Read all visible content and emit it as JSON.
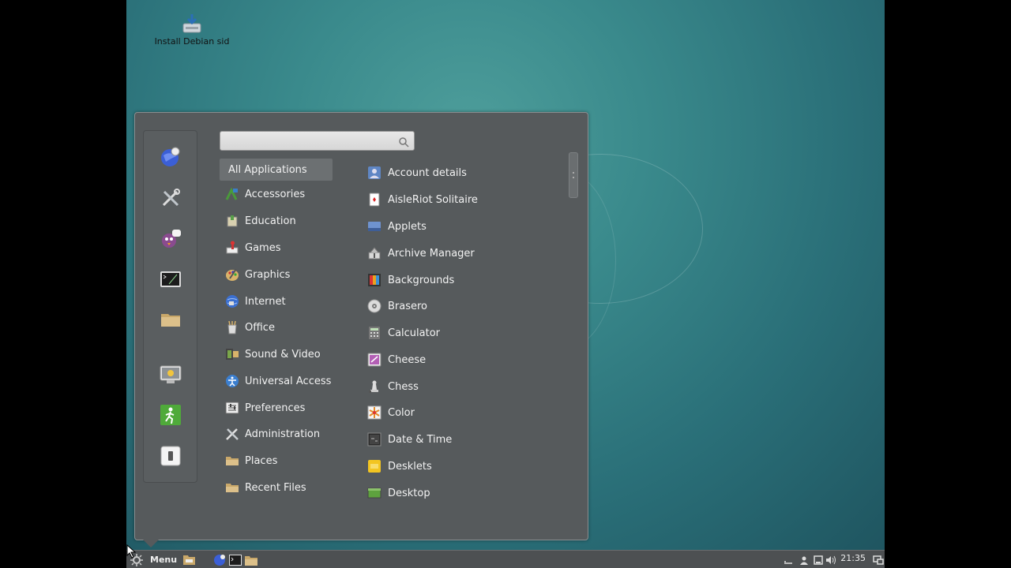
{
  "desktop": {
    "icons": [
      {
        "label": "Install Debian sid",
        "icon": "installer-icon"
      }
    ]
  },
  "menu": {
    "search": {
      "value": "",
      "placeholder": ""
    },
    "favorites": [
      {
        "name": "web-browser-icon"
      },
      {
        "name": "settings-tools-icon"
      },
      {
        "name": "chat-messenger-icon"
      },
      {
        "name": "terminal-icon"
      },
      {
        "name": "folder-icon"
      },
      {
        "name": "lock-screen-icon"
      },
      {
        "name": "logout-icon"
      },
      {
        "name": "shutdown-icon"
      }
    ],
    "categories": [
      {
        "label": "All Applications",
        "selected": true
      },
      {
        "label": "Accessories",
        "icon": "accessories-icon"
      },
      {
        "label": "Education",
        "icon": "education-icon"
      },
      {
        "label": "Games",
        "icon": "games-icon"
      },
      {
        "label": "Graphics",
        "icon": "graphics-icon"
      },
      {
        "label": "Internet",
        "icon": "internet-icon"
      },
      {
        "label": "Office",
        "icon": "office-icon"
      },
      {
        "label": "Sound & Video",
        "icon": "sound-video-icon"
      },
      {
        "label": "Universal Access",
        "icon": "universal-access-icon"
      },
      {
        "label": "Preferences",
        "icon": "preferences-icon"
      },
      {
        "label": "Administration",
        "icon": "administration-icon"
      },
      {
        "label": "Places",
        "icon": "places-folder-icon"
      },
      {
        "label": "Recent Files",
        "icon": "recent-files-folder-icon"
      }
    ],
    "apps": [
      {
        "label": "Account details",
        "icon": "account-details-icon"
      },
      {
        "label": "AisleRiot Solitaire",
        "icon": "solitaire-icon"
      },
      {
        "label": "Applets",
        "icon": "applets-icon"
      },
      {
        "label": "Archive Manager",
        "icon": "archive-manager-icon"
      },
      {
        "label": "Backgrounds",
        "icon": "backgrounds-icon"
      },
      {
        "label": "Brasero",
        "icon": "brasero-disc-icon"
      },
      {
        "label": "Calculator",
        "icon": "calculator-icon"
      },
      {
        "label": "Cheese",
        "icon": "cheese-icon"
      },
      {
        "label": "Chess",
        "icon": "chess-icon"
      },
      {
        "label": "Color",
        "icon": "color-icon"
      },
      {
        "label": "Date & Time",
        "icon": "date-time-icon"
      },
      {
        "label": "Desklets",
        "icon": "desklets-icon"
      },
      {
        "label": "Desktop",
        "icon": "desktop-icon"
      }
    ]
  },
  "taskbar": {
    "menu_label": "Menu",
    "clock": "21:35",
    "colors": {
      "panel": "#4d5052",
      "menu_bg": "#565a5c",
      "text": "#f2f2f2"
    }
  }
}
